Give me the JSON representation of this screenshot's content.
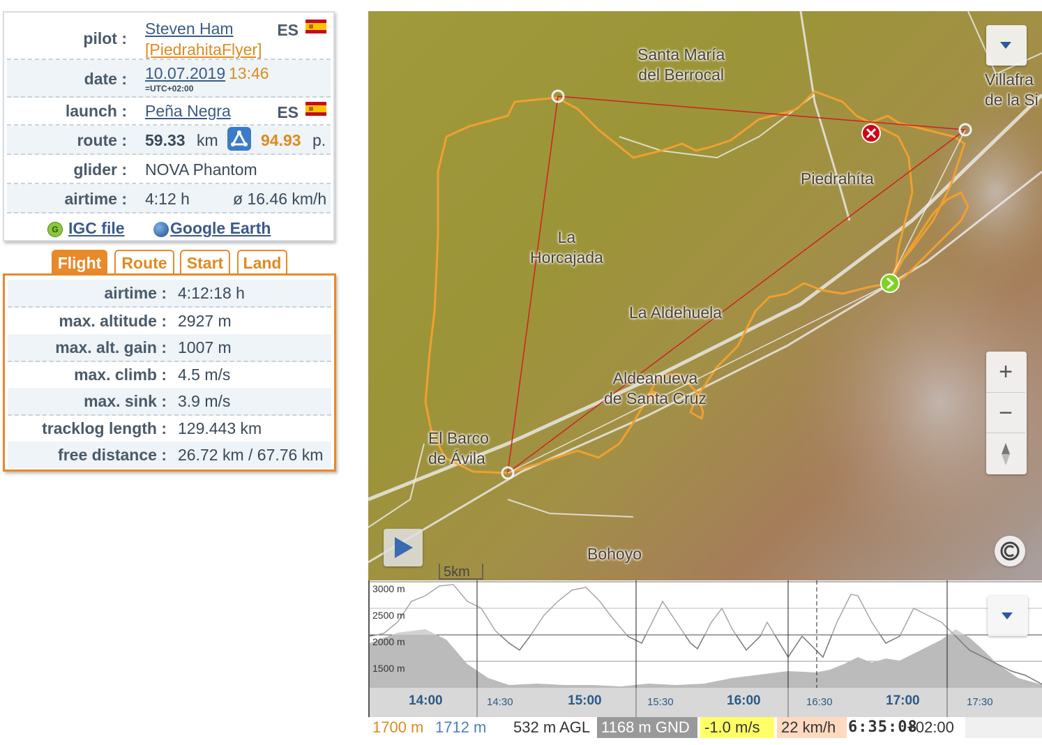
{
  "info": {
    "pilot_label": "pilot :",
    "pilot_name": "Steven Ham",
    "pilot_handle": "[PiedrahitaFlyer]",
    "pilot_country": "ES",
    "date_label": "date :",
    "date_value": "10.07.2019",
    "time_value": "13:46",
    "tz_value": "=UTC+02:00",
    "launch_label": "launch :",
    "launch_value": "Peña Negra",
    "launch_country": "ES",
    "route_label": "route :",
    "route_km": "59.33",
    "route_km_unit": "km",
    "route_points": "94.93",
    "route_points_unit": "p.",
    "glider_label": "glider :",
    "glider_value": "NOVA Phantom",
    "airtime_label": "airtime :",
    "airtime_value": "4:12 h",
    "speed_value": "ø 16.46 km/h",
    "igc_link": "IGC file",
    "ge_link": "Google Earth"
  },
  "tabs": [
    "Flight",
    "Route",
    "Start",
    "Land"
  ],
  "active_tab": "Flight",
  "stats": [
    {
      "label": "airtime :",
      "value": "4:12:18 h"
    },
    {
      "label": "max. altitude :",
      "value": "2927 m"
    },
    {
      "label": "max. alt. gain :",
      "value": "1007 m"
    },
    {
      "label": "max. climb :",
      "value": "4.5 m/s"
    },
    {
      "label": "max. sink :",
      "value": "3.9 m/s"
    },
    {
      "label": "tracklog length :",
      "value": "129.443 km"
    },
    {
      "label": "free distance :",
      "value": "26.72 km / 67.76 km"
    }
  ],
  "map": {
    "labels": {
      "santa_maria": "Santa María\ndel Berrocal",
      "villafranca": "Villafra\nde la Si",
      "piedrahita": "Piedrahíta",
      "horcajada": "La\nHorcajada",
      "aldehuela": "La Aldehuela",
      "aldeanueva": "Aldeanueva\nde Santa Cruz",
      "barco": "El Barco\nde Ávila",
      "bohoyo": "Bohoyo"
    },
    "scale_label": "5km",
    "zoom_in": "+",
    "zoom_out": "−",
    "colors": {
      "track": "#f0a030",
      "triangle": "#d02020",
      "start": "#7ed321",
      "land": "#d0021b"
    }
  },
  "profile": {
    "alt_labels": [
      "3000 m",
      "2500 m",
      "2000 m",
      "1500 m"
    ],
    "time_labels": [
      {
        "t": "14:00",
        "major": true
      },
      {
        "t": "14:30",
        "major": false
      },
      {
        "t": "15:00",
        "major": true
      },
      {
        "t": "15:30",
        "major": false
      },
      {
        "t": "16:00",
        "major": true
      },
      {
        "t": "16:30",
        "major": false
      },
      {
        "t": "17:00",
        "major": true
      },
      {
        "t": "17:30",
        "major": false
      }
    ]
  },
  "status": {
    "alt_gps": "1700 m",
    "alt_baro": "1712 m",
    "agl": "532 m AGL",
    "gnd": "1168 m GND",
    "vario": "-1.0 m/s",
    "speed": "22 km/h",
    "time": "6:35:08",
    "tz": "+02:00"
  }
}
